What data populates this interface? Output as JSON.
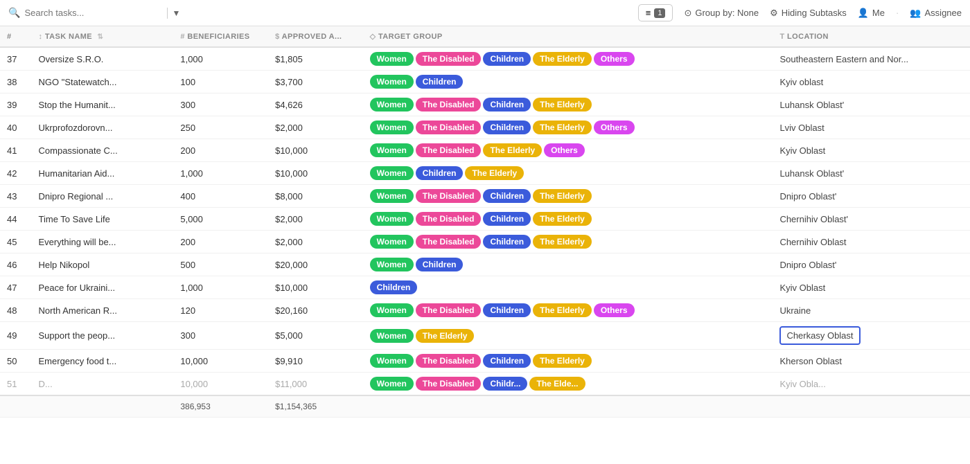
{
  "toolbar": {
    "search_placeholder": "Search tasks...",
    "filter_label": "1",
    "group_by_label": "Group by: None",
    "hiding_subtasks_label": "Hiding Subtasks",
    "me_label": "Me",
    "assignee_label": "Assignee"
  },
  "table": {
    "columns": [
      {
        "key": "num",
        "label": "#"
      },
      {
        "key": "task",
        "label": "Task Name",
        "icon": "↕"
      },
      {
        "key": "beneficiaries",
        "label": "# Beneficiaries",
        "icon": "#"
      },
      {
        "key": "approved",
        "label": "Approved A...",
        "icon": "$"
      },
      {
        "key": "target",
        "label": "Target Group",
        "icon": "◇"
      },
      {
        "key": "location",
        "label": "Location",
        "icon": "T"
      }
    ],
    "rows": [
      {
        "num": "37",
        "task": "Oversize S.R.O.",
        "beneficiaries": "1,000",
        "approved": "$1,805",
        "tags": [
          "Women",
          "The Disabled",
          "Children",
          "The Elderly",
          "Others"
        ],
        "location": "Southeastern Eastern and Nor..."
      },
      {
        "num": "38",
        "task": "NGO \"Statewatch...",
        "beneficiaries": "100",
        "approved": "$3,700",
        "tags": [
          "Women",
          "Children"
        ],
        "location": "Kyiv oblast"
      },
      {
        "num": "39",
        "task": "Stop the Humanit...",
        "beneficiaries": "300",
        "approved": "$4,626",
        "tags": [
          "Women",
          "The Disabled",
          "Children",
          "The Elderly"
        ],
        "location": "Luhansk Oblast'"
      },
      {
        "num": "40",
        "task": "Ukrprofozdorovn...",
        "beneficiaries": "250",
        "approved": "$2,000",
        "tags": [
          "Women",
          "The Disabled",
          "Children",
          "The Elderly",
          "Others"
        ],
        "location": "Lviv Oblast"
      },
      {
        "num": "41",
        "task": "Compassionate C...",
        "beneficiaries": "200",
        "approved": "$10,000",
        "tags": [
          "Women",
          "The Disabled",
          "The Elderly",
          "Others"
        ],
        "location": "Kyiv Oblast"
      },
      {
        "num": "42",
        "task": "Humanitarian Aid...",
        "beneficiaries": "1,000",
        "approved": "$10,000",
        "tags": [
          "Women",
          "Children",
          "The Elderly"
        ],
        "location": "Luhansk Oblast'"
      },
      {
        "num": "43",
        "task": "Dnipro Regional ...",
        "beneficiaries": "400",
        "approved": "$8,000",
        "tags": [
          "Women",
          "The Disabled",
          "Children",
          "The Elderly"
        ],
        "location": "Dnipro Oblast'"
      },
      {
        "num": "44",
        "task": "Time To Save Life",
        "beneficiaries": "5,000",
        "approved": "$2,000",
        "tags": [
          "Women",
          "The Disabled",
          "Children",
          "The Elderly"
        ],
        "location": "Chernihiv Oblast'"
      },
      {
        "num": "45",
        "task": "Everything will be...",
        "beneficiaries": "200",
        "approved": "$2,000",
        "tags": [
          "Women",
          "The Disabled",
          "Children",
          "The Elderly"
        ],
        "location": "Chernihiv Oblast"
      },
      {
        "num": "46",
        "task": "Help Nikopol",
        "beneficiaries": "500",
        "approved": "$20,000",
        "tags": [
          "Women",
          "Children"
        ],
        "location": "Dnipro Oblast'"
      },
      {
        "num": "47",
        "task": "Peace for Ukraini...",
        "beneficiaries": "1,000",
        "approved": "$10,000",
        "tags": [
          "Children"
        ],
        "location": "Kyiv Oblast"
      },
      {
        "num": "48",
        "task": "North American R...",
        "beneficiaries": "120",
        "approved": "$20,160",
        "tags": [
          "Women",
          "The Disabled",
          "Children",
          "The Elderly",
          "Others"
        ],
        "location": "Ukraine"
      },
      {
        "num": "49",
        "task": "Support the peop...",
        "beneficiaries": "300",
        "approved": "$5,000",
        "tags": [
          "Women",
          "The Elderly"
        ],
        "location": "Cherkasy Oblast",
        "location_selected": true
      },
      {
        "num": "50",
        "task": "Emergency food t...",
        "beneficiaries": "10,000",
        "approved": "$9,910",
        "tags": [
          "Women",
          "The Disabled",
          "Children",
          "The Elderly"
        ],
        "location": "Kherson Oblast"
      },
      {
        "num": "51",
        "task": "D...",
        "beneficiaries": "10,000",
        "approved": "$11,000",
        "tags": [
          "Women",
          "The Disabled",
          "Childr...",
          "The Elde..."
        ],
        "location": "Kyiv Obla..."
      }
    ],
    "footer": {
      "beneficiaries_total": "386,953",
      "approved_total": "$1,154,365"
    }
  },
  "tag_colors": {
    "Women": "women",
    "The Disabled": "disabled",
    "Children": "children",
    "The Elderly": "elderly",
    "Others": "others",
    "Childr...": "children",
    "The Elde...": "elderly"
  }
}
